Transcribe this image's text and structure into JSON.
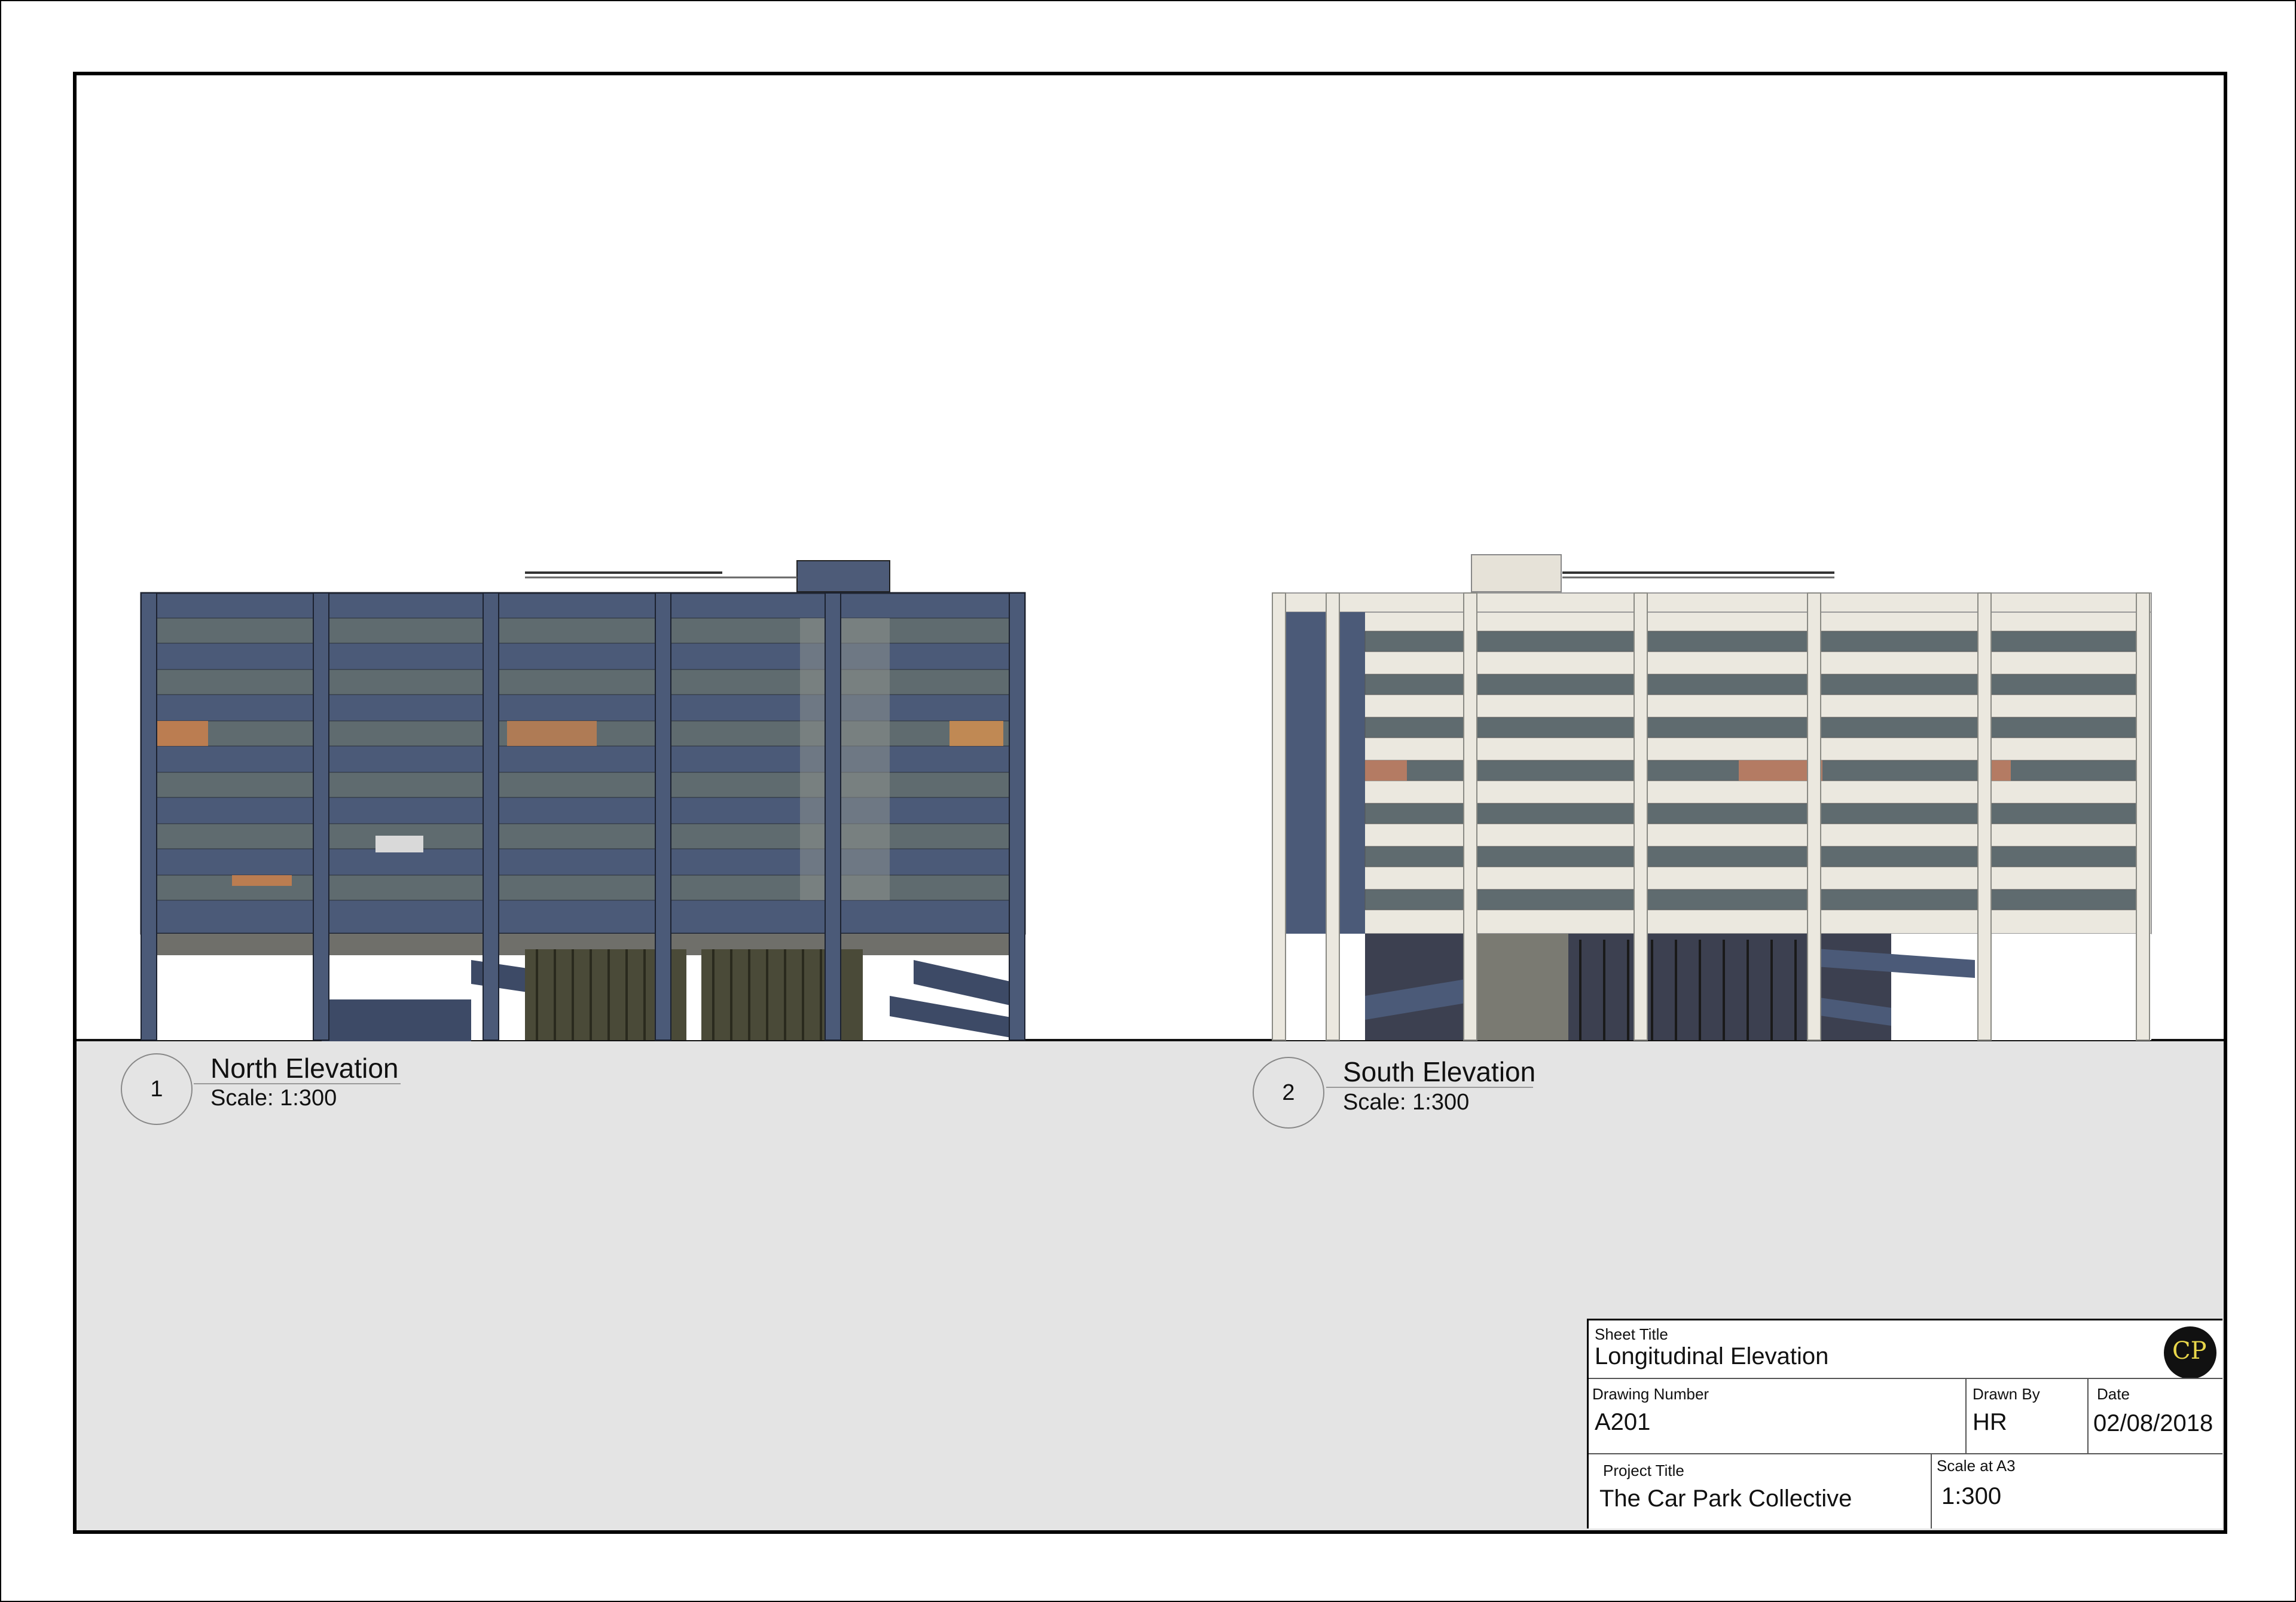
{
  "views": [
    {
      "number": "1",
      "title": "North Elevation",
      "scale": "Scale: 1:300"
    },
    {
      "number": "2",
      "title": "South Elevation",
      "scale": "Scale: 1:300"
    }
  ],
  "title_block": {
    "sheet_title_label": "Sheet Title",
    "sheet_title": "Longitudinal Elevation",
    "drawing_number_label": "Drawing Number",
    "drawing_number": "A201",
    "drawn_by_label": "Drawn By",
    "drawn_by": "HR",
    "date_label": "Date",
    "date": "02/08/2018",
    "project_title_label": "Project Title",
    "project_title": "The Car Park Collective",
    "scale_label": "Scale at A3",
    "scale": "1:300",
    "logo_text": "CP"
  },
  "colors": {
    "north_facade": "#4b5a78",
    "south_facade": "#ebe8df",
    "glass": "#5f6b6f",
    "ground": "#e4e4e4"
  }
}
